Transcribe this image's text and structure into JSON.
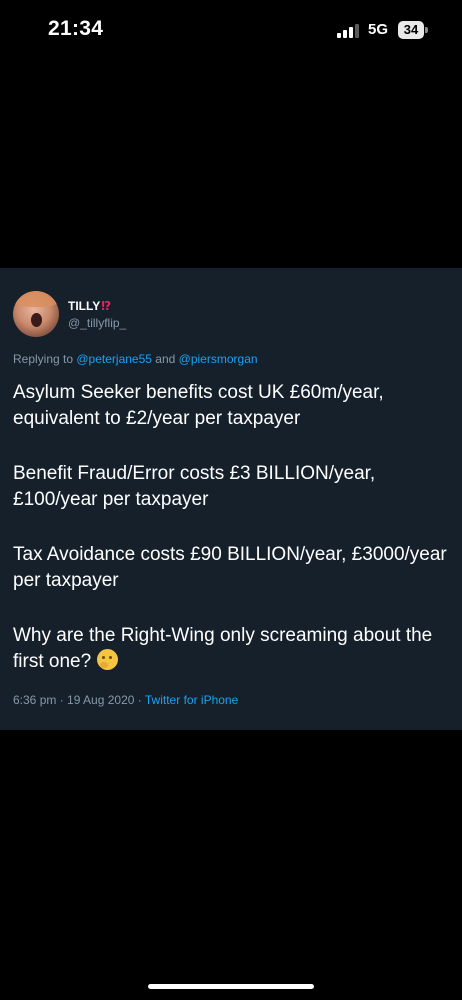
{
  "status_bar": {
    "time": "21:34",
    "network": "5G",
    "battery": "34",
    "signal_icon": "cellular-signal-icon",
    "battery_icon": "battery-icon"
  },
  "tweet": {
    "display_name": "TILLY",
    "name_emoji": "⁉",
    "handle": "@_tillyflip_",
    "reply_prefix": "Replying to ",
    "reply_user_1": "@peterjane55",
    "reply_and": " and ",
    "reply_user_2": "@piersmorgan",
    "paragraphs": [
      "Asylum Seeker benefits cost UK £60m/year, equivalent to £2/year per taxpayer",
      "Benefit Fraud/Error costs £3 BILLION/year, £100/year per taxpayer",
      "Tax Avoidance costs £90 BILLION/year, £3000/year per taxpayer",
      "Why are the Right-Wing only screaming about the first one?"
    ],
    "emoji_icon": "thinking-face-icon",
    "time": "6:36 pm",
    "separator": " · ",
    "date": "19 Aug 2020",
    "source": "Twitter for iPhone"
  },
  "colors": {
    "background": "#000000",
    "card": "#15202b",
    "secondary_text": "#8899a6",
    "link": "#1da1f2",
    "emoji_accent": "#e0245e"
  }
}
